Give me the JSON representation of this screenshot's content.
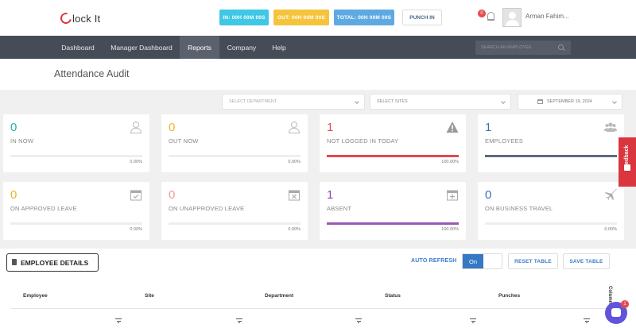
{
  "header": {
    "logo_text": "lock It",
    "pill_in": "IN: 00H 00M 00S",
    "pill_out": "OUT: 00H 00M 00S",
    "pill_total": "TOTAL: 00H 00M 00S",
    "punch_in": "PUNCH IN",
    "notification_count": "0",
    "user_name": "Arman Fahim..."
  },
  "nav": {
    "items": [
      "Dashboard",
      "Manager Dashboard",
      "Reports",
      "Company",
      "Help"
    ],
    "active": "Reports",
    "search_placeholder": "SEARCH AN EMPLOYEE"
  },
  "page": {
    "title": "Attendance Audit"
  },
  "filters": {
    "department_placeholder": "SELECT DEPARTMENT",
    "sites_placeholder": "SELECT SITES",
    "date": "SEPTEMBER 19, 2024"
  },
  "cards": [
    {
      "value": "0",
      "label": "IN NOW",
      "percent": "0.00%",
      "fill": 0,
      "color": "#26b5a3",
      "bar_color": "#26b5a3",
      "icon": "user-icon"
    },
    {
      "value": "0",
      "label": "OUT NOW",
      "percent": "0.00%",
      "fill": 0,
      "color": "#f0b429",
      "bar_color": "#f0b429",
      "icon": "user-icon"
    },
    {
      "value": "1",
      "label": "NOT LOGGED IN TODAY",
      "percent": "100.00%",
      "fill": 1,
      "color": "#e5484f",
      "bar_color": "#e5484f",
      "icon": "warning-icon"
    },
    {
      "value": "1",
      "label": "EMPLOYEES",
      "percent": "",
      "fill": 1,
      "color": "#3d6db5",
      "bar_color": "#5a6a80",
      "icon": "group-icon"
    },
    {
      "value": "0",
      "label": "ON APPROVED LEAVE",
      "percent": "0.00%",
      "fill": 0,
      "color": "#f0b429",
      "bar_color": "#f0b429",
      "icon": "calendar-check-icon"
    },
    {
      "value": "0",
      "label": "ON UNAPPROVED LEAVE",
      "percent": "0.00%",
      "fill": 0,
      "color": "#f19a9a",
      "bar_color": "#f19a9a",
      "icon": "calendar-x-icon"
    },
    {
      "value": "1",
      "label": "ABSENT",
      "percent": "100.00%",
      "fill": 1,
      "color": "#8e44ad",
      "bar_color": "#9b59b6",
      "icon": "calendar-plus-icon"
    },
    {
      "value": "0",
      "label": "ON BUSINESS TRAVEL",
      "percent": "0.00%",
      "fill": 0,
      "color": "#3d6db5",
      "bar_color": "#3d6db5",
      "icon": "plane-icon"
    }
  ],
  "feedback": {
    "label": "Feedback"
  },
  "table": {
    "details_button": "EMPLOYEE DETAILS",
    "auto_refresh_label": "AUTO REFRESH",
    "toggle_value": "On",
    "reset_button": "RESET TABLE",
    "save_button": "SAVE TABLE",
    "columns_tab": "Columns",
    "headers": [
      "Employee",
      "Site",
      "Department",
      "Status",
      "Punches"
    ]
  },
  "chat": {
    "badge": "1"
  }
}
